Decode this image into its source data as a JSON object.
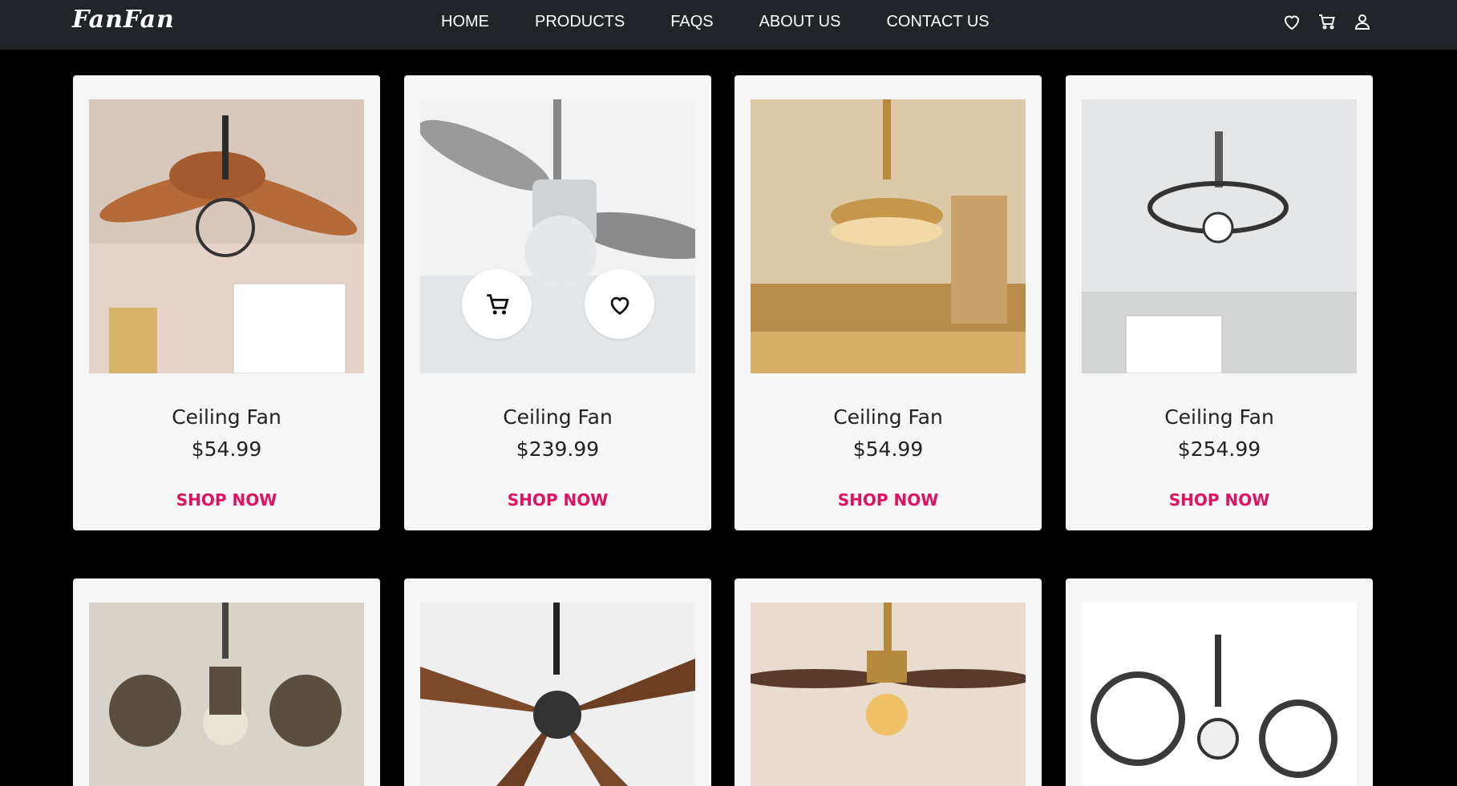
{
  "brand": {
    "logo": "FanFan"
  },
  "nav": {
    "links": [
      "HOME",
      "PRODUCTS",
      "FAQS",
      "ABOUT US",
      "CONTACT US"
    ]
  },
  "icons": [
    "heart-icon",
    "cart-icon",
    "user-icon"
  ],
  "accent_color": "#e0115f",
  "products": [
    {
      "name": "Ceiling Fan",
      "price": "$54.99",
      "cta": "SHOP NOW"
    },
    {
      "name": "Ceiling Fan",
      "price": "$239.99",
      "cta": "SHOP NOW"
    },
    {
      "name": "Ceiling Fan",
      "price": "$54.99",
      "cta": "SHOP NOW"
    },
    {
      "name": "Ceiling Fan",
      "price": "$254.99",
      "cta": "SHOP NOW"
    }
  ]
}
